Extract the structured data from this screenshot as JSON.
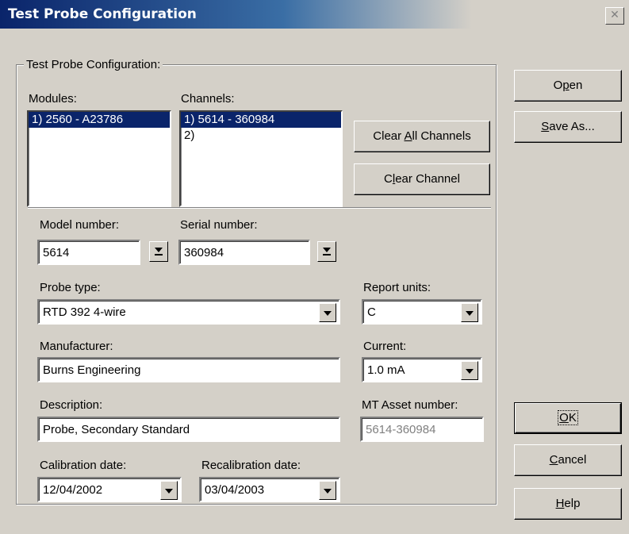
{
  "window": {
    "title": "Test Probe Configuration",
    "close_glyph": "✕"
  },
  "group": {
    "legend": "Test Probe Configuration:"
  },
  "modules": {
    "label": "Modules:",
    "items": [
      "1) 2560 - A23786"
    ],
    "selected_index": 0
  },
  "channels": {
    "label": "Channels:",
    "items": [
      "1) 5614 - 360984",
      "2)"
    ],
    "selected_index": 0
  },
  "buttons": {
    "clear_all_pre": "Clear ",
    "clear_all_mn": "A",
    "clear_all_post": "ll Channels",
    "clear_ch_pre": "C",
    "clear_ch_mn": "l",
    "clear_ch_post": "ear Channel",
    "open_pre": "O",
    "open_mn": "p",
    "open_post": "en",
    "saveas_mn": "S",
    "saveas_post": "ave As...",
    "ok_mn": "O",
    "ok_post": "K",
    "cancel_mn": "C",
    "cancel_post": "ancel",
    "help_mn": "H",
    "help_post": "elp"
  },
  "fields": {
    "model_label": "Model number:",
    "model_value": "5614",
    "serial_label": "Serial number:",
    "serial_value": "360984",
    "probe_label": "Probe type:",
    "probe_value": "RTD 392 4-wire",
    "units_label": "Report units:",
    "units_value": "C",
    "mfr_label": "Manufacturer:",
    "mfr_value": "Burns Engineering",
    "current_label": "Current:",
    "current_value": "1.0 mA",
    "desc_label": "Description:",
    "desc_value": "Probe, Secondary Standard",
    "asset_label": "MT Asset number:",
    "asset_value": "5614-360984",
    "cal_label": "Calibration date:",
    "cal_value": "12/04/2002",
    "recal_label": "Recalibration date:",
    "recal_value": "03/04/2003"
  },
  "icons": {
    "dropdown": "chevron-down-icon",
    "spin": "down-arrow-bar-icon",
    "close": "close-icon"
  },
  "colors": {
    "title_start": "#0a246a",
    "title_end": "#3a6ea5",
    "selection": "#0a246a",
    "face": "#d4d0c8"
  }
}
